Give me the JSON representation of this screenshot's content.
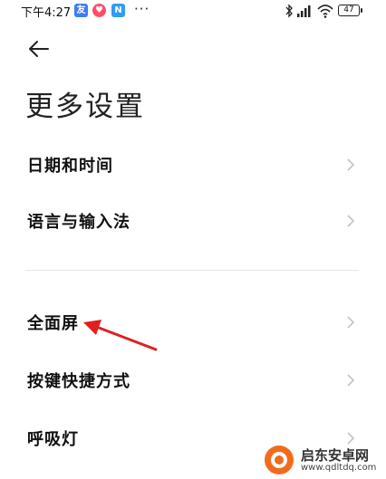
{
  "status_bar": {
    "time": "下午4:27",
    "app_icons": [
      "友",
      "♥",
      "N"
    ],
    "more": "···",
    "battery": "47"
  },
  "header": {
    "back_icon": "arrow-left-icon",
    "title": "更多设置"
  },
  "settings": {
    "group1": [
      {
        "label": "日期和时间"
      },
      {
        "label": "语言与输入法"
      }
    ],
    "group2": [
      {
        "label": "全面屏"
      },
      {
        "label": "按键快捷方式"
      },
      {
        "label": "呼吸灯"
      }
    ]
  },
  "watermark": {
    "title": "启东安卓网",
    "url": "www.qdltdq.com"
  },
  "colors": {
    "annotation_arrow": "#e02020",
    "watermark_accent": "#f26b1d"
  }
}
